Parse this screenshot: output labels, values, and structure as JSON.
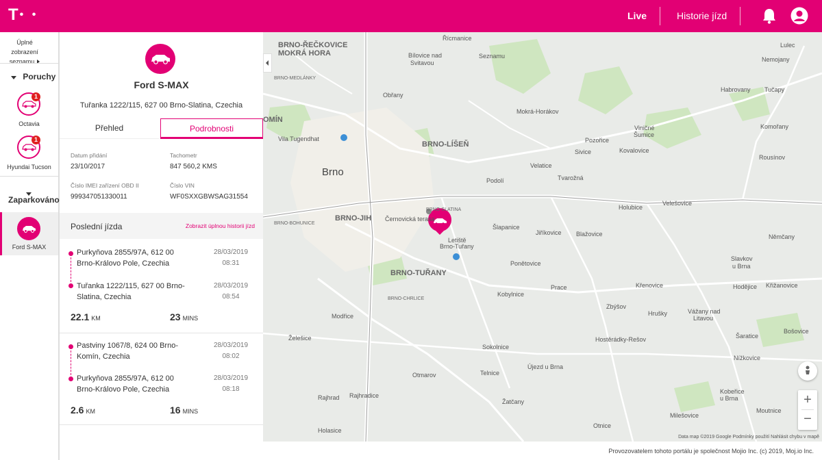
{
  "header": {
    "logo": "T",
    "logo_dots": "• •",
    "nav_live": "Live",
    "nav_history": "Historie jízd"
  },
  "rail": {
    "full_view": "Úplné zobrazení seznamu",
    "section_faults": "Poruchy",
    "section_parked": "Zaparkováno",
    "vehicles": [
      {
        "label": "Octavia",
        "badge": "1"
      },
      {
        "label": "Hyundai Tucson",
        "badge": "1"
      },
      {
        "label": "Ford S-MAX",
        "badge": ""
      }
    ]
  },
  "vehicle": {
    "name": "Ford S-MAX",
    "address": "Tuřanka 1222/115, 627 00 Brno-Slatina, Czechia"
  },
  "tabs": {
    "overview": "Přehled",
    "details": "Podrobnosti"
  },
  "details": {
    "date_added_label": "Datum přidání",
    "date_added": "23/10/2017",
    "odometer_label": "Tachometr",
    "odometer": "847 560,2 KMS",
    "imei_label": "Číslo IMEI zařízení OBD II",
    "imei": "999347051330011",
    "vin_label": "Číslo VIN",
    "vin": "WF0SXXGBWSAG31554"
  },
  "last_trip": {
    "title": "Poslední jízda",
    "link": "Zobrazit úplnou historii jízd"
  },
  "trips": [
    {
      "from_line1": "Purkyňova 2855/97A, 612 00",
      "from_line2": "Brno-Královo Pole, Czechia",
      "from_date": "28/03/2019",
      "from_time": "08:31",
      "to_line1": "Tuřanka 1222/115, 627 00 Brno-",
      "to_line2": "Slatina, Czechia",
      "to_date": "28/03/2019",
      "to_time": "08:54",
      "distance": "22.1",
      "distance_unit": "KM",
      "duration": "23",
      "duration_unit": "MINS"
    },
    {
      "from_line1": "Pastviny 1067/8, 624 00 Brno-",
      "from_line2": "Komín, Czechia",
      "from_date": "28/03/2019",
      "from_time": "08:02",
      "to_line1": "Purkyňova 2855/97A, 612 00",
      "to_line2": "Brno-Královo Pole, Czechia",
      "to_date": "28/03/2019",
      "to_time": "08:18",
      "distance": "2.6",
      "distance_unit": "KM",
      "duration": "16",
      "duration_unit": "MINS"
    }
  ],
  "map": {
    "labels": [
      "Řícmanice",
      "BRNO-ŘEČKOVICE",
      "MOKRÁ HORA",
      "Bílovice nad",
      "Svitavou",
      "Seznamu",
      "Lulec",
      "Nemojany",
      "Habrovany",
      "Tučapy",
      "BRNO-MEDLÁNKY",
      "Obřany",
      "Mokrá-Horákov",
      "OMÍN",
      "Komořany",
      "Viničné",
      "Šumice",
      "Pozořice",
      "Kovalovice",
      "Rousínov",
      "Vila Tugendhat",
      "BRNO-LÍŠEŇ",
      "Sivice",
      "Velatice",
      "Tvarožná",
      "Brno",
      "Podolí",
      "Holubice",
      "Velešovice",
      "Černovická terasa",
      "BRNO-SLATINA",
      "BRNO-JIH",
      "BRNO-BOHUNICE",
      "Šlapanice",
      "Jiříkovice",
      "Blažovice",
      "Letiště",
      "Brno-Tuřany",
      "Němčany",
      "Ponětovice",
      "BRNO-TUŘANY",
      "Slavkov",
      "u Brna",
      "Kobylnice",
      "Prace",
      "Křenovice",
      "Hodějice",
      "Křižanovice",
      "BRNO-CHRLICE",
      "Modřice",
      "Zbýšov",
      "Hrušky",
      "Vážany nad",
      "Litavou",
      "Želešice",
      "Sokolnice",
      "Telnice",
      "Šaratice",
      "Otmarov",
      "Újezd u Brna",
      "Nížkovice",
      "Rajhrad",
      "Rajhradice",
      "Kobeřice",
      "u Brna",
      "Žatčany",
      "Otnice",
      "Holasice",
      "Milešovice",
      "Moutnice",
      "Hostěrádky-Rešov",
      "Bošovice"
    ],
    "attribution": "Data map ©2019 Google   Podmínky použití   Nahlásit chybu v mapě"
  },
  "footer": {
    "text": "Provozovatelem tohoto portálu je společnost Mojio Inc. (c) 2019, Moj.io Inc."
  },
  "colors": {
    "brand": "#e20074",
    "badge": "#e02020"
  }
}
